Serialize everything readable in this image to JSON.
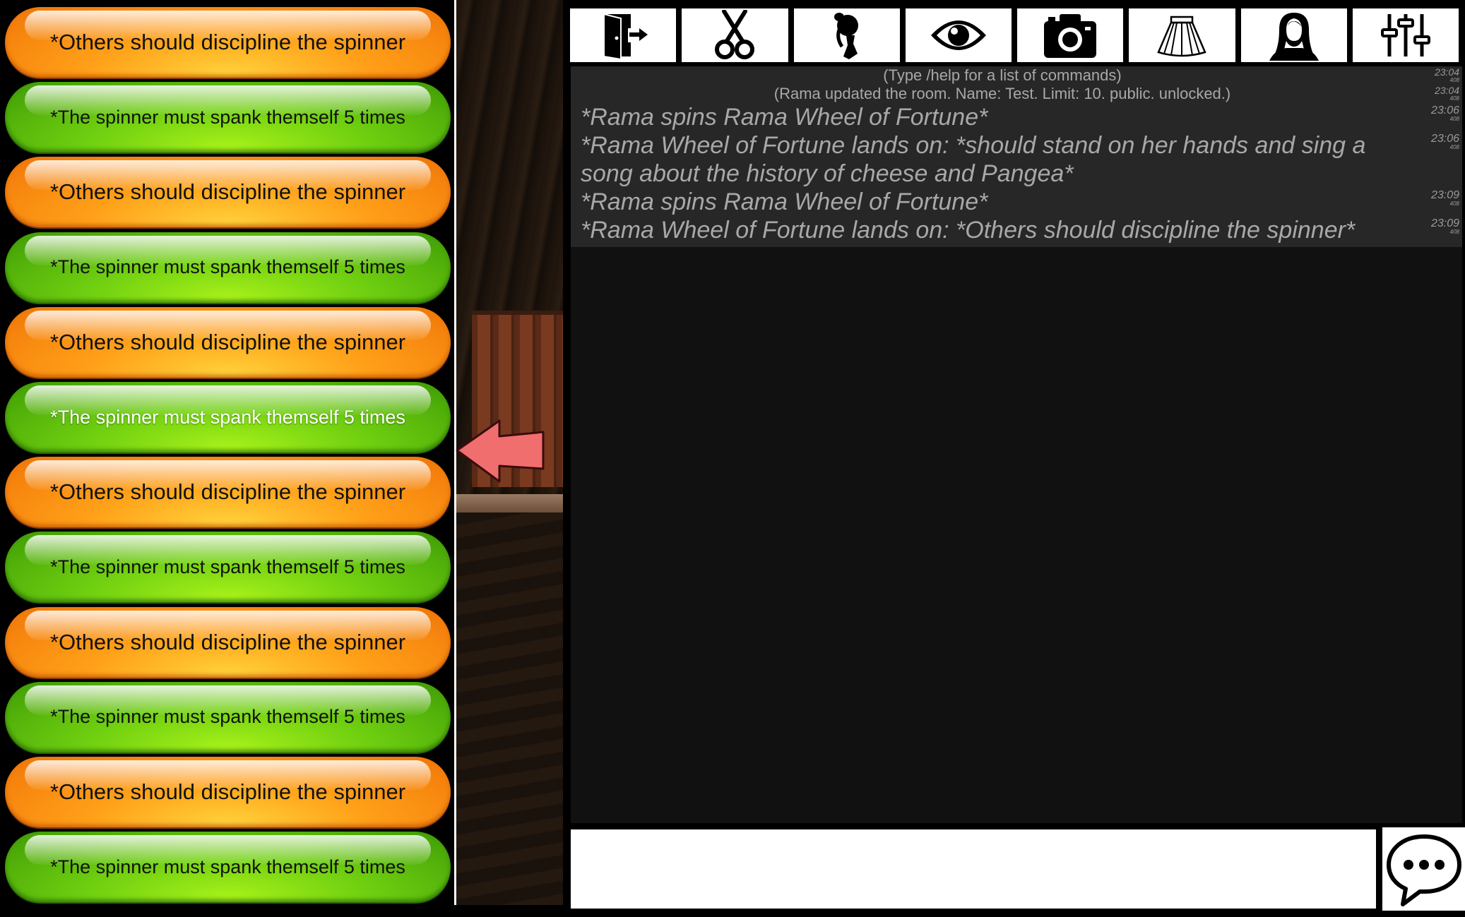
{
  "segments": [
    {
      "label": "*Others should discipline the spinner",
      "color": "orange",
      "selected": false
    },
    {
      "label": "*The spinner must spank themself 5 times",
      "color": "green",
      "selected": false
    },
    {
      "label": "*Others should discipline the spinner",
      "color": "orange",
      "selected": false
    },
    {
      "label": "*The spinner must spank themself 5 times",
      "color": "green",
      "selected": false
    },
    {
      "label": "*Others should discipline the spinner",
      "color": "orange",
      "selected": false
    },
    {
      "label": "*The spinner must spank themself 5 times",
      "color": "green",
      "selected": true
    },
    {
      "label": "*Others should discipline the spinner",
      "color": "orange",
      "selected": false
    },
    {
      "label": "*The spinner must spank themself 5 times",
      "color": "green",
      "selected": false
    },
    {
      "label": "*Others should discipline the spinner",
      "color": "orange",
      "selected": false
    },
    {
      "label": "*The spinner must spank themself 5 times",
      "color": "green",
      "selected": false
    },
    {
      "label": "*Others should discipline the spinner",
      "color": "orange",
      "selected": false
    },
    {
      "label": "*The spinner must spank themself 5 times",
      "color": "green",
      "selected": false
    }
  ],
  "toolbar": [
    {
      "icon": "exit-door-icon"
    },
    {
      "icon": "scissors-icon"
    },
    {
      "icon": "hair-silhouette-icon"
    },
    {
      "icon": "eye-icon"
    },
    {
      "icon": "camera-icon"
    },
    {
      "icon": "skirt-icon"
    },
    {
      "icon": "character-silhouette-icon"
    },
    {
      "icon": "sliders-icon"
    }
  ],
  "chat": {
    "messages": [
      {
        "type": "system",
        "text": "(Type /help for a list of commands)",
        "time": "23:04",
        "sub": "408"
      },
      {
        "type": "system",
        "text": "(Rama updated the room. Name: Test. Limit: 10.  public.  unlocked.)",
        "time": "23:04",
        "sub": "408"
      },
      {
        "type": "action",
        "text": "*Rama spins Rama Wheel of Fortune*",
        "time": "23:06",
        "sub": "408"
      },
      {
        "type": "action",
        "text": "*Rama Wheel of Fortune lands on: *should stand on her hands and sing a song about the history of cheese and Pangea*",
        "time": "23:06",
        "sub": "408"
      },
      {
        "type": "action",
        "text": "*Rama spins Rama Wheel of Fortune*",
        "time": "23:09",
        "sub": "408"
      },
      {
        "type": "action",
        "text": "*Rama Wheel of Fortune lands on: *Others should discipline the spinner*",
        "time": "23:09",
        "sub": "408"
      }
    ],
    "input_value": "",
    "send_icon": "speech-bubble-icon"
  },
  "pointer_icon": "red-arrow-pointer-icon",
  "colors": {
    "orange": "#ff9f18",
    "green": "#6fcf10",
    "pointer": "#f06e6e",
    "chat_bg": "#111111",
    "log_bg": "#272727"
  }
}
